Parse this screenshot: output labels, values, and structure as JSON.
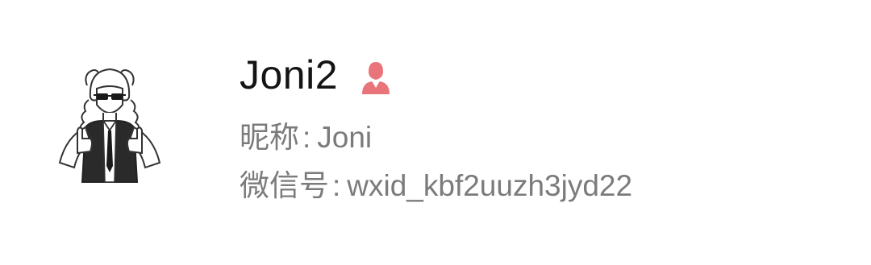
{
  "profile": {
    "display_name": "Joni2",
    "gender_icon": "female-person-icon",
    "nickname_label": "昵称",
    "nickname_value": "Joni",
    "wechat_id_label": "微信号",
    "wechat_id_value": "wxid_kbf2uuzh3jyd22",
    "separator": ":"
  },
  "colors": {
    "name_text": "#141414",
    "detail_text": "#7b7b7b",
    "gender_icon": "#e9747a",
    "background": "#ffffff"
  }
}
